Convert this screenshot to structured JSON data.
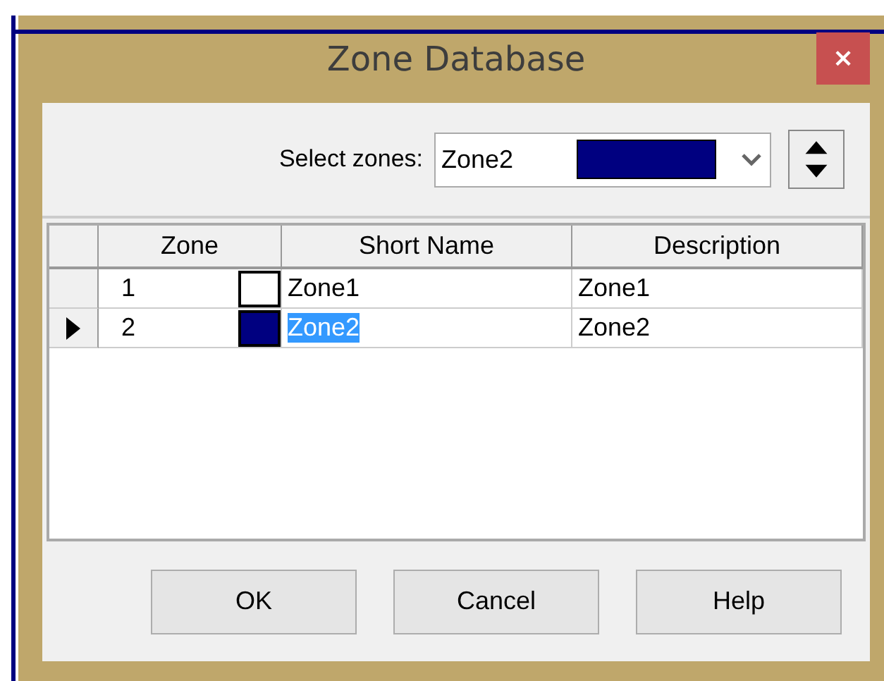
{
  "window": {
    "title": "Zone Database",
    "close": "×"
  },
  "selector": {
    "label": "Select zones:",
    "value": "Zone2",
    "color": "#000080"
  },
  "table": {
    "columns": [
      "Zone",
      "Short Name",
      "Description"
    ],
    "rows": [
      {
        "zone": "1",
        "color": "#ffffff",
        "short_name": "Zone1",
        "description": "Zone1",
        "selected": false
      },
      {
        "zone": "2",
        "color": "#000080",
        "short_name": "Zone2",
        "description": "Zone2",
        "selected": true
      }
    ]
  },
  "buttons": [
    "OK",
    "Cancel",
    "Help"
  ]
}
